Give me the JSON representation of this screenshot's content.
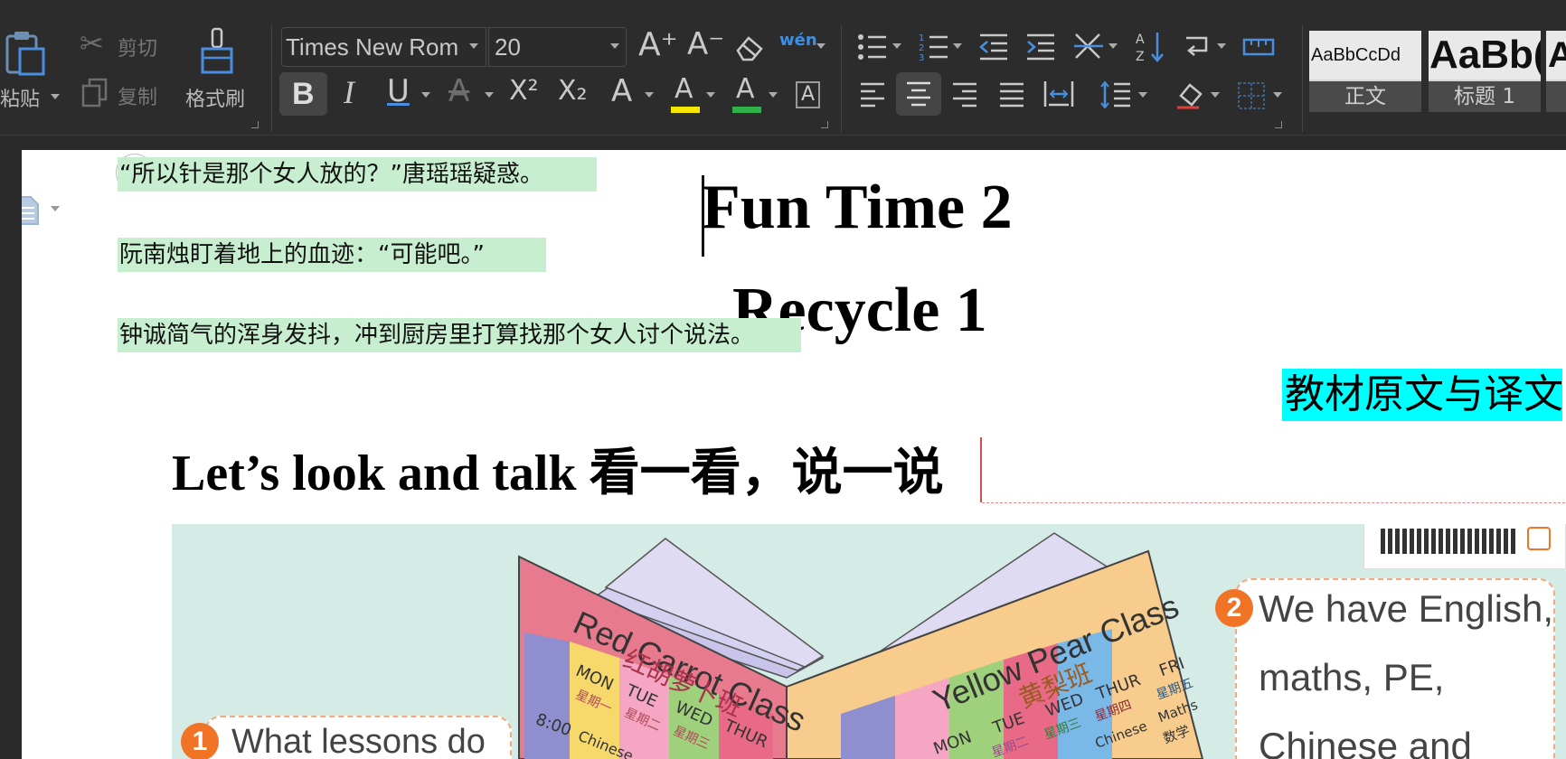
{
  "toolbar": {
    "clipboard": {
      "paste_label": "粘贴",
      "cut_label": "剪切",
      "copy_label": "复制",
      "format_painter_label": "格式刷"
    },
    "font": {
      "family": "Times New Rom",
      "size": "20"
    },
    "formatting_icons": {
      "grow_font": "A⁺",
      "shrink_font": "A⁻",
      "phonetic": "wén",
      "bold": "B",
      "italic": "I",
      "underline": "U",
      "superscript": "X²",
      "subscript": "X₂",
      "text_effect": "A",
      "highlight": "A",
      "font_color": "A",
      "char_border": "A"
    },
    "styles": [
      {
        "sample": "AaBbCcDd",
        "name": "正文"
      },
      {
        "sample": "AaBb(",
        "name": "标题 1"
      },
      {
        "sample": "A",
        "name": ""
      }
    ],
    "colors": {
      "highlight_underline": "#f5e600",
      "font_color_underline": "#2fb24a",
      "phonetic_blue": "#3b8fe8"
    }
  },
  "document": {
    "highlighted_lines": [
      "“所以针是那个女人放的？”唐瑶瑶疑惑。",
      "阮南烛盯着地上的血迹：“可能吧。”",
      "钟诚简气的浑身发抖，冲到厨房里打算找那个女人讨个说法。"
    ],
    "title_1": "Fun Time 2",
    "title_2": "Recycle 1",
    "cyan_label": "教材原文与译文",
    "section_heading": "Let’s look and talk 看一看，说一说",
    "highlight_color": "#c7efcf",
    "cyan_color": "#00ffff"
  },
  "illustration": {
    "left_book_title": "Red Carrot Class",
    "left_book_subtitle": "红胡萝卜班",
    "right_book_title": "Yellow Pear Class",
    "right_book_subtitle": "黄梨班",
    "left_days": [
      "MON",
      "TUE",
      "WED",
      "THUR"
    ],
    "left_days_cn": [
      "星期一",
      "星期二",
      "星期三"
    ],
    "right_days": [
      "MON",
      "TUE",
      "WED",
      "THUR",
      "FRI"
    ],
    "right_days_cn": [
      "星期二",
      "星期三",
      "星期四",
      "星期五"
    ],
    "time": "8:00",
    "left_subject": "Chinese",
    "right_subjects": [
      "Chinese",
      "Maths",
      "数学"
    ],
    "bubble_1_num": "1",
    "bubble_1_text": "What lessons do",
    "bubble_2_num": "2",
    "bubble_2_lines": [
      "We have English,",
      "maths, PE,",
      "Chinese and"
    ]
  }
}
